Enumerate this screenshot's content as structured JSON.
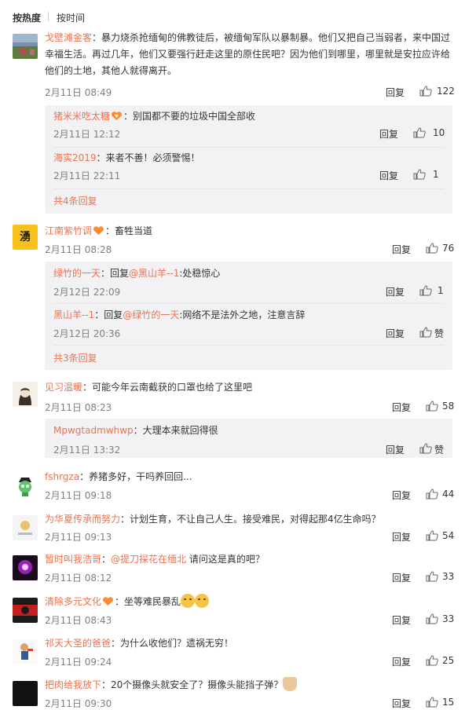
{
  "sort": {
    "hot": "按热度",
    "time": "按时间"
  },
  "reply_label": "回复",
  "like_zero_label": "赞",
  "comments": [
    {
      "user": "戈壁滩金客",
      "text": "：暴力烧杀抢缅甸的佛教徒后，被缅甸军队以暴制暴。他们又把自己当弱者，来中国过幸福生活。再过几年，他们又要强行赶走这里的原住民吧？因为他们到哪里，哪里就是安拉应许给他们的土地，其他人就得离开。",
      "time": "2月11日 08:49",
      "likes": "122",
      "replies": [
        {
          "user": "猪米米吃太糖",
          "text": "：别国都不要的垃圾中国全部收",
          "time": "2月11日 12:12",
          "likes": "10"
        },
        {
          "user": "海实2019",
          "text": "：来者不善！必须警惕！",
          "time": "2月11日 22:11",
          "likes": "1"
        }
      ],
      "more": "共4条回复"
    },
    {
      "user": "江南紫竹调",
      "text": "：畜牲当道",
      "time": "2月11日 08:28",
      "likes": "76",
      "replies": [
        {
          "user": "绿竹的一天",
          "pre": "：回复",
          "mention": "@黑山羊--1",
          "text": ":处稳惊心",
          "time": "2月12日 22:09",
          "likes": "1"
        },
        {
          "user": "黑山羊--1",
          "pre": "：回复",
          "mention": "@绿竹的一天",
          "text": ":网络不是法外之地，注意言辞",
          "time": "2月12日 20:36",
          "likes": "赞"
        }
      ],
      "more": "共3条回复"
    },
    {
      "user": "见习温暖",
      "text": "：可能今年云南截获的口罩也给了这里吧",
      "time": "2月11日 08:23",
      "likes": "58",
      "replies": [
        {
          "user": "Mpwgtadmwhwp",
          "text": "：大理本来就回得很",
          "time": "2月11日 13:32",
          "likes": "赞"
        }
      ]
    },
    {
      "user": "fshrgza",
      "text": "：养猪多好，干吗养回回...",
      "time": "2月11日 09:18",
      "likes": "44"
    },
    {
      "user": "为华夏传承而努力",
      "text": "：计划生育，不让自己人生。接受难民，对得起那4亿生命吗？",
      "time": "2月11日 09:13",
      "likes": "54"
    },
    {
      "user": "暂时叫我浩哥",
      "pre": "：",
      "mention": "@提刀探花在缅北",
      "text": " 请问这是真的吧？",
      "time": "2月11日 08:12",
      "likes": "33"
    },
    {
      "user": "清除多元文化",
      "text": "：坐等难民暴乱",
      "time": "2月11日 08:43",
      "likes": "33"
    },
    {
      "user": "祁天大圣的爸爸",
      "text": "：为什么收他们？遗祸无穷！",
      "time": "2月11日 09:24",
      "likes": "25"
    },
    {
      "user": "把肉给我放下",
      "text": "：20个摄像头就安全了？摄像头能挡子弹？",
      "time": "2月11日 09:30",
      "likes": "15"
    }
  ],
  "avatar_glyphs": {
    "c2": "湧"
  },
  "colors": {
    "accent": "#eb7350",
    "reply_bg": "#f2f2f5",
    "time": "#808080"
  }
}
